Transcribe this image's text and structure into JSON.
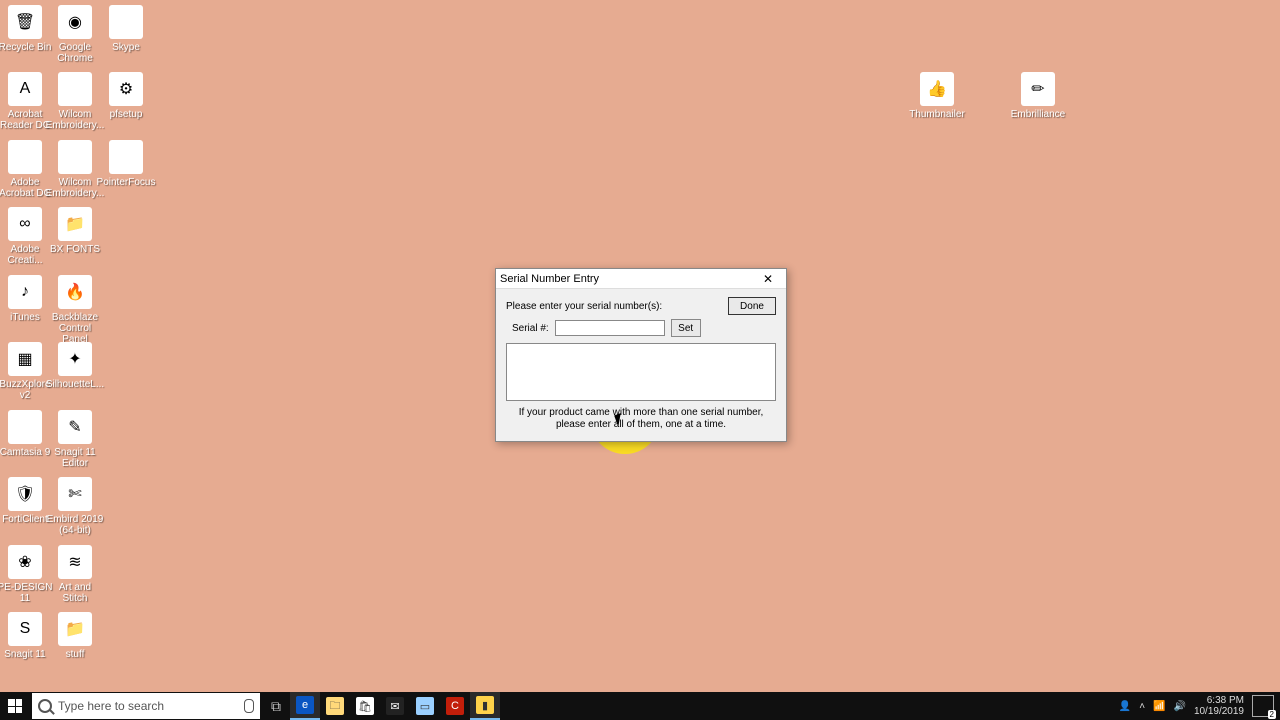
{
  "desktop": {
    "left_icons": [
      {
        "label": "Recycle Bin",
        "name": "recycle-bin-icon",
        "bg": "bg-white",
        "glyph": "🗑"
      },
      {
        "label": "Google Chrome",
        "name": "google-chrome-icon",
        "bg": "bg-white",
        "glyph": "◉"
      },
      {
        "label": "Skype",
        "name": "skype-icon",
        "bg": "bg-sky",
        "glyph": "S"
      },
      {
        "label": "Acrobat Reader DC",
        "name": "acrobat-reader-icon",
        "bg": "bg-red",
        "glyph": "A"
      },
      {
        "label": "Wilcom Embroidery...",
        "name": "wilcom-embroidery-icon-1",
        "bg": "bg-blue",
        "glyph": "ES"
      },
      {
        "label": "pfsetup",
        "name": "pfsetup-icon",
        "bg": "bg-white",
        "glyph": "⚙"
      },
      {
        "label": "Adobe Acrobat DC",
        "name": "adobe-acrobat-icon",
        "bg": "bg-dark",
        "glyph": "A"
      },
      {
        "label": "Wilcom Embroidery...",
        "name": "wilcom-embroidery-icon-2",
        "bg": "bg-blue",
        "glyph": "ES"
      },
      {
        "label": "PointerFocus",
        "name": "pointerfocus-icon",
        "bg": "bg-dark",
        "glyph": "◎"
      },
      {
        "label": "Adobe Creati...",
        "name": "adobe-creative-icon",
        "bg": "bg-red",
        "glyph": "∞"
      },
      {
        "label": "BX FONTS",
        "name": "bx-fonts-icon",
        "bg": "bg-folder",
        "glyph": "📁"
      },
      {
        "label": "iTunes",
        "name": "itunes-icon",
        "bg": "bg-white",
        "glyph": "♪"
      },
      {
        "label": "Backblaze Control Panel",
        "name": "backblaze-icon",
        "bg": "bg-white",
        "glyph": "🔥"
      },
      {
        "label": "BuzzXplore v2",
        "name": "buzzxplore-icon",
        "bg": "bg-white",
        "glyph": "▦"
      },
      {
        "label": "SilhouetteL...",
        "name": "silhouette-icon",
        "bg": "bg-white",
        "glyph": "✦"
      },
      {
        "label": "Camtasia 9",
        "name": "camtasia-icon",
        "bg": "bg-green",
        "glyph": "C"
      },
      {
        "label": "Snagit 11 Editor",
        "name": "snagit-editor-icon",
        "bg": "bg-white",
        "glyph": "✎"
      },
      {
        "label": "FortiClient",
        "name": "forticlient-icon",
        "bg": "bg-white",
        "glyph": "🛡"
      },
      {
        "label": "Embird 2019 (64-bit)",
        "name": "embird-icon",
        "bg": "bg-white",
        "glyph": "✄"
      },
      {
        "label": "PE-DESIGN 11",
        "name": "pe-design-icon",
        "bg": "bg-white",
        "glyph": "❀"
      },
      {
        "label": "Art and Stitch",
        "name": "art-stitch-icon",
        "bg": "bg-yellow",
        "glyph": "≋"
      },
      {
        "label": "Snagit 11",
        "name": "snagit-icon",
        "bg": "bg-white",
        "glyph": "S"
      },
      {
        "label": "stuff",
        "name": "stuff-icon",
        "bg": "bg-folder",
        "glyph": "📁"
      }
    ],
    "right_icons": [
      {
        "label": "Thumbnailer",
        "name": "thumbnailer-icon",
        "bg": "bg-white",
        "glyph": "👍"
      },
      {
        "label": "Embrilliance",
        "name": "embrilliance-icon",
        "bg": "bg-white",
        "glyph": "✏"
      }
    ]
  },
  "dialog": {
    "title": "Serial Number Entry",
    "prompt": "Please enter your serial number(s):",
    "serial_label": "Serial #:",
    "serial_value": "",
    "set_label": "Set",
    "done_label": "Done",
    "hint_line1": "If your product came with more than one serial number,",
    "hint_line2": "please enter all of them, one at a time."
  },
  "taskbar": {
    "search_placeholder": "Type here to search",
    "apps": [
      {
        "name": "edge-icon",
        "bg": "#0a56c2",
        "glyph": "e",
        "active": true
      },
      {
        "name": "file-explorer-icon",
        "bg": "#ffd97a",
        "glyph": "🗀",
        "active": false
      },
      {
        "name": "store-icon",
        "bg": "#fff",
        "glyph": "🛍",
        "active": false
      },
      {
        "name": "mail-icon",
        "bg": "#222",
        "glyph": "✉",
        "active": false
      },
      {
        "name": "notepad-icon",
        "bg": "#9bd0ff",
        "glyph": "▭",
        "active": false
      },
      {
        "name": "camtasia-task-icon",
        "bg": "#c21e0a",
        "glyph": "C",
        "active": false
      },
      {
        "name": "embrilliance-task-icon",
        "bg": "#ffd24a",
        "glyph": "▮",
        "active": true
      }
    ],
    "time": "6:38 PM",
    "date": "10/19/2019",
    "notif_count": "2"
  }
}
